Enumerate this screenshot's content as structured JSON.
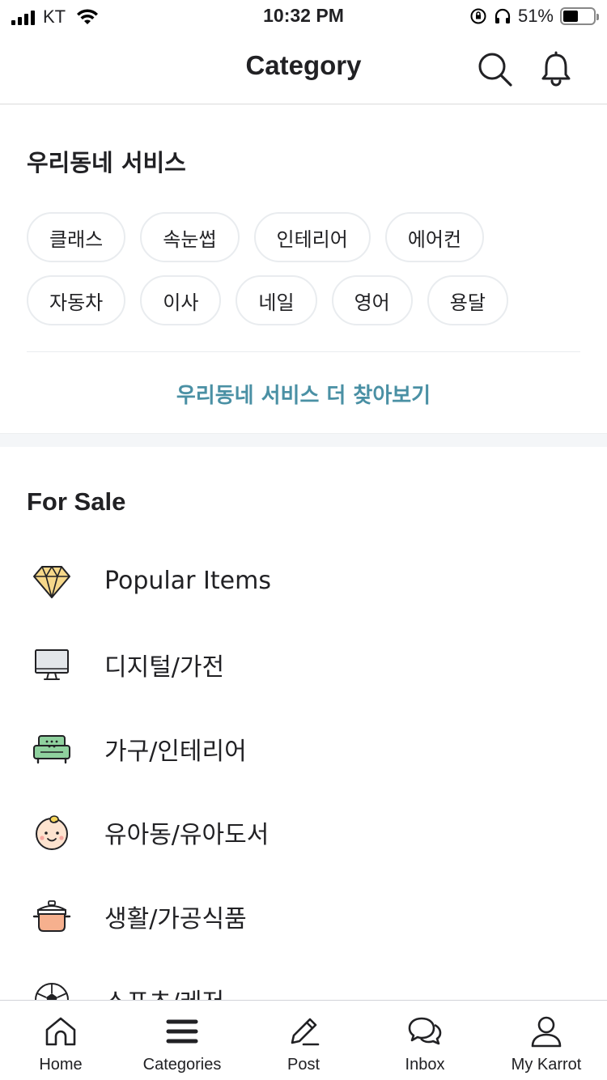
{
  "status_bar": {
    "carrier": "KT",
    "time": "10:32 PM",
    "battery_pct": "51%",
    "battery_level": 0.51
  },
  "header": {
    "title": "Category",
    "icons": [
      "search-icon",
      "bell-icon"
    ]
  },
  "services": {
    "title": "우리동네 서비스",
    "rows": [
      [
        "클래스",
        "속눈썹",
        "인테리어",
        "에어컨"
      ],
      [
        "자동차",
        "이사",
        "네일",
        "영어",
        "용달"
      ]
    ],
    "more_label": "우리동네 서비스 더 찾아보기",
    "accent_color": "#4a90a4"
  },
  "for_sale": {
    "title": "For Sale",
    "items": [
      {
        "label": "Popular Items",
        "icon": "diamond-icon"
      },
      {
        "label": "디지털/가전",
        "icon": "monitor-icon"
      },
      {
        "label": "가구/인테리어",
        "icon": "sofa-icon"
      },
      {
        "label": "유아동/유아도서",
        "icon": "baby-icon"
      },
      {
        "label": "생활/가공식품",
        "icon": "pot-icon"
      },
      {
        "label": "스포츠/레저",
        "icon": "soccer-ball-icon"
      }
    ]
  },
  "tab_bar": {
    "tabs": [
      {
        "label": "Home",
        "icon": "home-icon"
      },
      {
        "label": "Categories",
        "icon": "menu-icon"
      },
      {
        "label": "Post",
        "icon": "pencil-icon"
      },
      {
        "label": "Inbox",
        "icon": "chat-icon"
      },
      {
        "label": "My Karrot",
        "icon": "person-icon"
      }
    ]
  }
}
